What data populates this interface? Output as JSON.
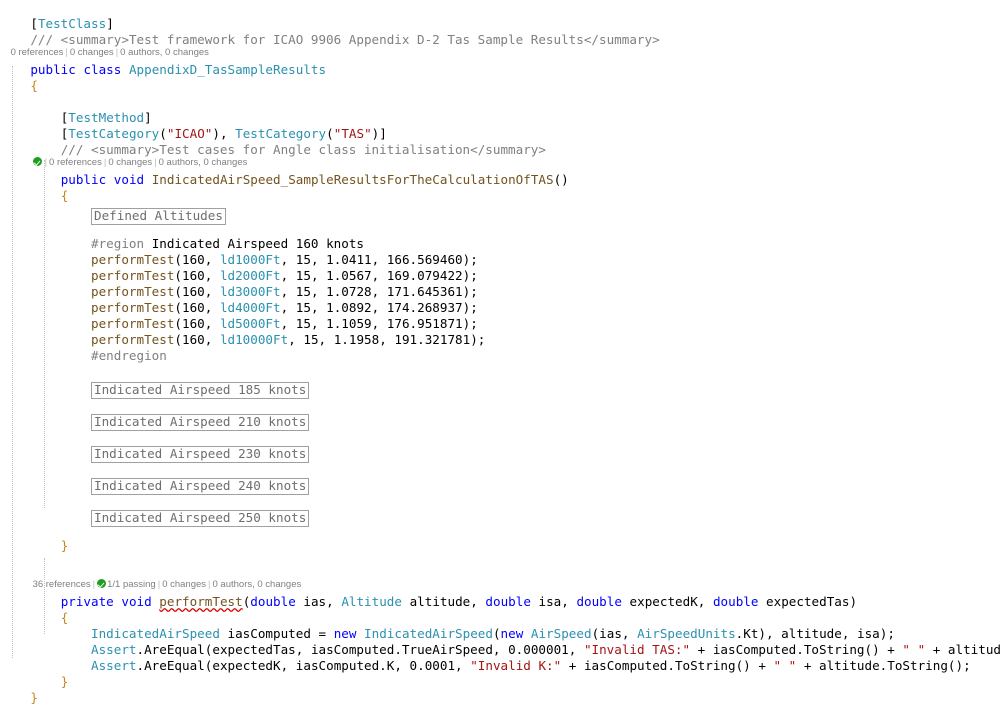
{
  "editor": {
    "language": "csharp",
    "colors": {
      "background": "#FFFFFF",
      "keyword": "#0000FF",
      "type": "#2B91AF",
      "string": "#A31515",
      "comment": "#008000",
      "preprocessor": "#808080",
      "method": "#74531F",
      "brace_highlight": "#C8851B",
      "codelens": "#808080",
      "collapsed_border": "#A0A0A0",
      "error_squiggle": "#D90000",
      "test_pass": "#1E9E1E"
    }
  },
  "codelens": {
    "class_level": {
      "references": "0 references",
      "changes": "0 changes",
      "authors": "0 authors, 0 changes"
    },
    "test_method_level": {
      "references": "0 references",
      "changes": "0 changes",
      "authors": "0 authors, 0 changes"
    },
    "helper_method_level": {
      "references": "36 references",
      "passing": "1/1 passing",
      "changes": "0 changes",
      "authors": "0 authors, 0 changes"
    },
    "separator": "|"
  },
  "code": {
    "attribute_testclass": "[TestClass]",
    "doc_class": "/// <summary>Test framework for ICAO 9906 Appendix D-2 Tas Sample Results</summary>",
    "class_decl": {
      "modifier": "public",
      "kind": "class",
      "name": "AppendixD_TasSampleResults"
    },
    "open_brace": "{",
    "close_brace": "}",
    "attribute_testmethod": "[TestMethod]",
    "attribute_testcategory": "[TestCategory(\"ICAO\"), TestCategory(\"TAS\")]",
    "testcategory_parts": {
      "prefix": "[",
      "name1": "TestCategory",
      "open1": "(",
      "arg1": "\"ICAO\"",
      "close1": ")",
      "comma": ", ",
      "name2": "TestCategory",
      "open2": "(",
      "arg2": "\"TAS\"",
      "close2": ")",
      "suffix": "]"
    },
    "doc_method": "/// <summary>Test cases for Angle class initialisation</summary>",
    "test_method_decl": {
      "modifier": "public",
      "returns": "void",
      "name": "IndicatedAirSpeed_SampleResultsForTheCalculationOfTAS",
      "params": "()"
    },
    "region_160": {
      "start": "#region Indicated Airspeed 160 knots",
      "end": "#endregion",
      "directive_start": "#region",
      "label": "Indicated Airspeed 160 knots",
      "directive_end": "#endregion"
    },
    "perform_tests": [
      {
        "call": "performTest",
        "ias": "160",
        "altitude": "ld1000Ft",
        "isa": "15",
        "k": "1.0411",
        "tas": "166.569460"
      },
      {
        "call": "performTest",
        "ias": "160",
        "altitude": "ld2000Ft",
        "isa": "15",
        "k": "1.0567",
        "tas": "169.079422"
      },
      {
        "call": "performTest",
        "ias": "160",
        "altitude": "ld3000Ft",
        "isa": "15",
        "k": "1.0728",
        "tas": "171.645361"
      },
      {
        "call": "performTest",
        "ias": "160",
        "altitude": "ld4000Ft",
        "isa": "15",
        "k": "1.0892",
        "tas": "174.268937"
      },
      {
        "call": "performTest",
        "ias": "160",
        "altitude": "ld5000Ft",
        "isa": "15",
        "k": "1.1059",
        "tas": "176.951871"
      },
      {
        "call": "performTest",
        "ias": "160",
        "altitude": "ld10000Ft",
        "isa": "15",
        "k": "1.1958",
        "tas": "191.321781"
      }
    ],
    "collapsed_regions": [
      "Defined Altitudes",
      "Indicated Airspeed 185 knots",
      "Indicated Airspeed 210 knots",
      "Indicated Airspeed 230 knots",
      "Indicated Airspeed 240 knots",
      "Indicated Airspeed 250 knots"
    ],
    "helper_method": {
      "modifier": "private",
      "returns": "void",
      "name": "performTest",
      "signature_open": "(",
      "signature_close": ")",
      "parameters": [
        {
          "type": "double",
          "name": "ias",
          "is_keyword": true
        },
        {
          "type": "Altitude",
          "name": "altitude",
          "is_keyword": false
        },
        {
          "type": "double",
          "name": "isa",
          "is_keyword": true
        },
        {
          "type": "double",
          "name": "expectedK",
          "is_keyword": true
        },
        {
          "type": "double",
          "name": "expectedTas",
          "is_keyword": true
        }
      ]
    },
    "body": {
      "decl_type": "IndicatedAirSpeed",
      "decl_var": "iasComputed",
      "decl_eq": "=",
      "decl_new": "new",
      "decl_ctor": "IndicatedAirSpeed",
      "decl_inner_new": "new",
      "decl_inner_ctor": "AirSpeed",
      "decl_inner_arg1": "ias",
      "decl_inner_arg2_type": "AirSpeedUnits",
      "decl_inner_arg2_member": ".Kt",
      "decl_arg2": "altitude",
      "decl_arg3": "isa",
      "assert1": {
        "klass": "Assert",
        "member": ".AreEqual",
        "arg_expected": "expectedTas",
        "arg_actual": "iasComputed.TrueAirSpeed",
        "arg_delta": "0.000001",
        "message": "\"Invalid TAS:\"",
        "concat1": "iasComputed.ToString()",
        "space_literal": "\" \"",
        "concat2": "altitude.ToString()"
      },
      "assert2": {
        "klass": "Assert",
        "member": ".AreEqual",
        "arg_expected": "expectedK",
        "arg_actual": "iasComputed.K",
        "arg_delta": "0.0001",
        "message": "\"Invalid K:\"",
        "concat1": "iasComputed.ToString()",
        "space_literal": "\" \"",
        "concat2": "altitude.ToString()"
      }
    }
  }
}
